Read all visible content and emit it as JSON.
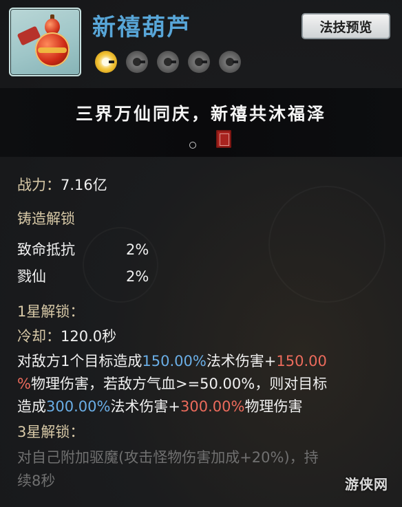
{
  "header": {
    "title": "新禧葫芦",
    "preview_button": "法技预览",
    "stars": {
      "filled": 1,
      "total": 5
    }
  },
  "banner": {
    "motto": "三界万仙同庆，新禧共沐福泽"
  },
  "details": {
    "power_label": "战力：",
    "power_value": "7.16亿",
    "forge_unlock_title": "铸造解锁",
    "forge_stats": [
      {
        "name": "致命抵抗",
        "value": "2%"
      },
      {
        "name": "戮仙",
        "value": "2%"
      }
    ],
    "star1_title": "1星解锁：",
    "cooldown_label": "冷却：",
    "cooldown_value": "120.0秒",
    "star1_desc": {
      "l1_a": "对敌方1个目标造成",
      "l1_b": "150.00%",
      "l1_c": "法术伤害+",
      "l1_d": "150.00",
      "l2_a": "%",
      "l2_b": "物理伤害，若敌方气血>=50.00%，则对目标",
      "l3_a": "造成",
      "l3_b": "300.00%",
      "l3_c": "法术伤害+",
      "l3_d": "300.00%",
      "l3_e": "物理伤害"
    },
    "star3_title": "3星解锁：",
    "star3_desc": {
      "l1": "对自己附加驱魔(攻击怪物伤害加成+20%)，持",
      "l2": "续8秒"
    }
  },
  "watermark": "游侠网",
  "colors": {
    "title_blue": "#58a6d8",
    "value_blue": "#6aaee6",
    "value_red": "#ec6b5c",
    "label_gold": "#d8c9a7",
    "locked_gray": "#707070"
  }
}
